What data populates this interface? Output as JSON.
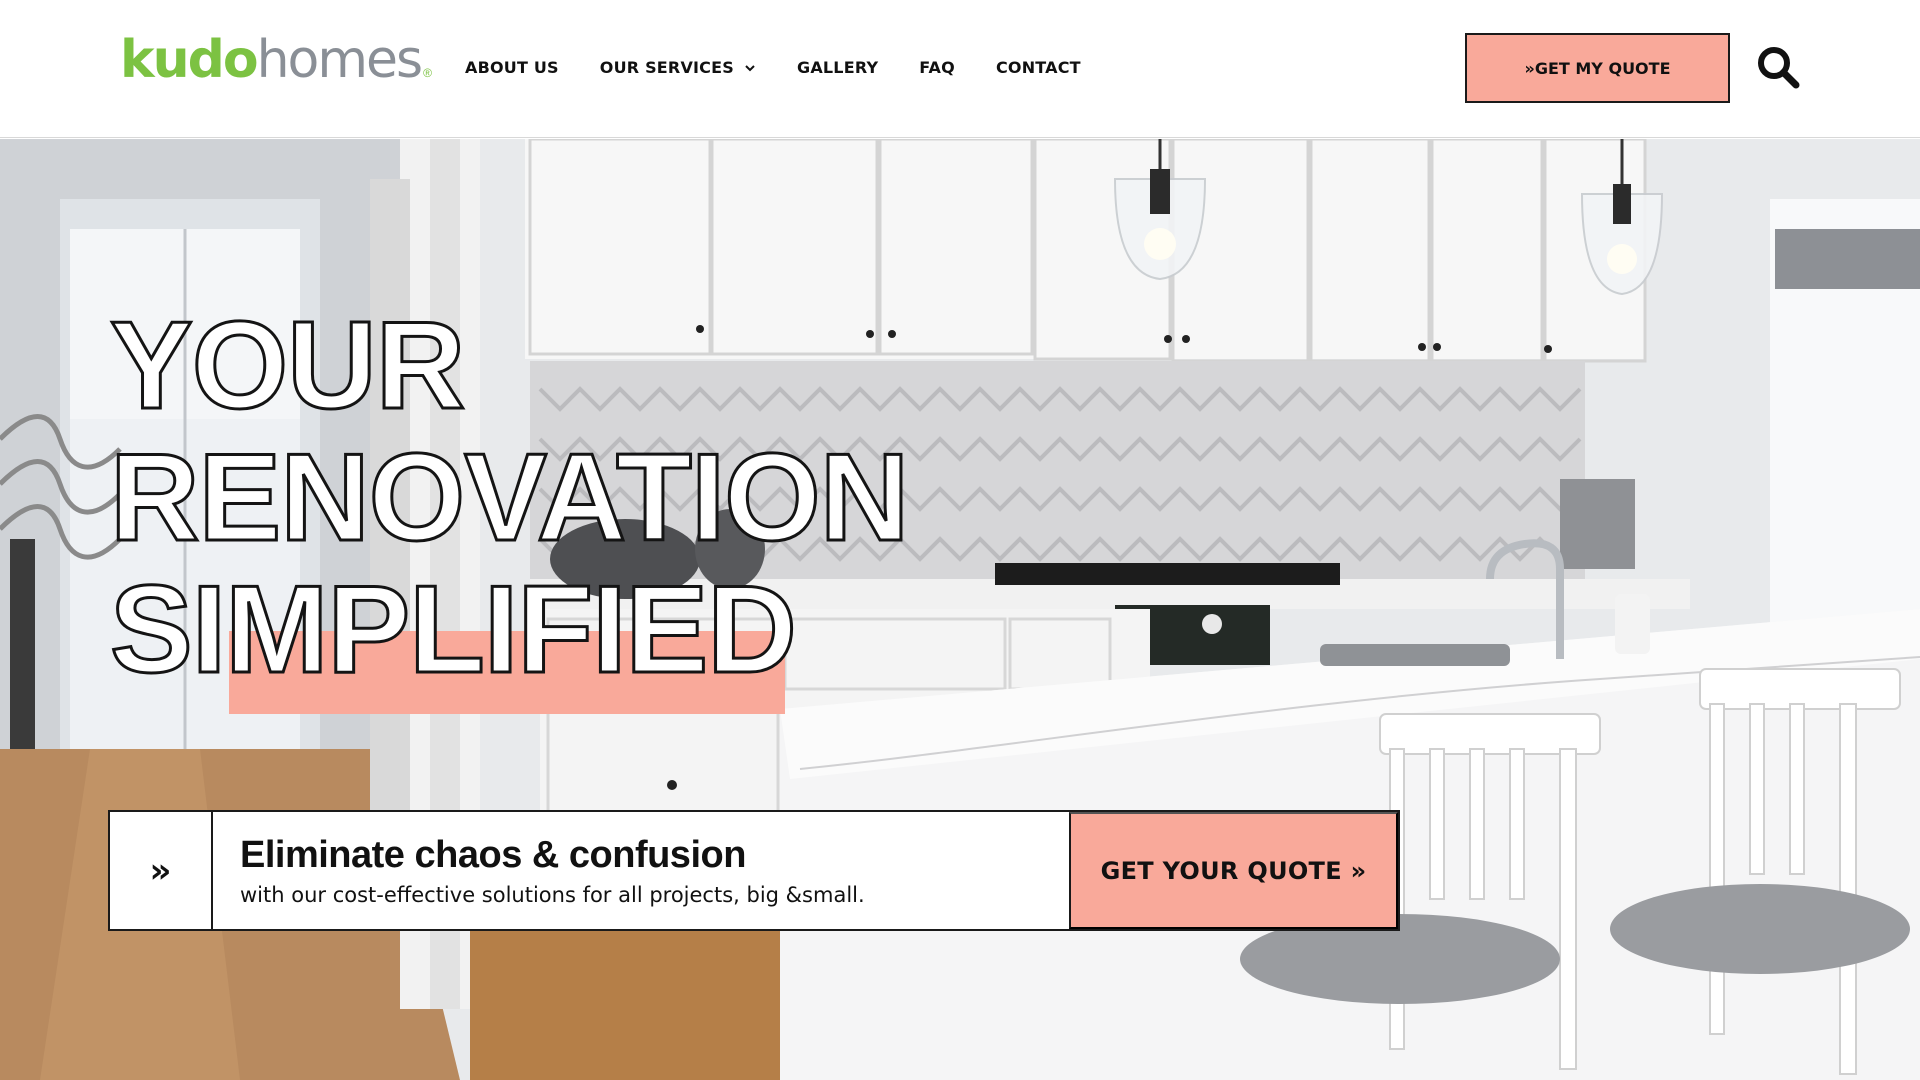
{
  "brand": {
    "logo_primary": "kudo",
    "logo_secondary": "homes",
    "logo_mark": "®",
    "primary_color": "#7cc242",
    "secondary_color": "#8a8f96",
    "accent_color": "#f9a99a"
  },
  "nav": {
    "items": [
      {
        "label": "ABOUT US"
      },
      {
        "label": "OUR SERVICES",
        "has_dropdown": true
      },
      {
        "label": "GALLERY"
      },
      {
        "label": "FAQ"
      },
      {
        "label": "CONTACT"
      }
    ]
  },
  "header": {
    "quote_button": "»GET MY QUOTE",
    "search_icon": "search-icon"
  },
  "hero": {
    "headline_lines": [
      "YOUR",
      "RENOVATION",
      "SIMPLIFIED"
    ],
    "background": "kitchen-renovation-photo"
  },
  "cta": {
    "arrow": "»",
    "title": "Eliminate chaos & confusion",
    "subtitle": "with our cost-effective solutions for all projects, big &small.",
    "button": "GET YOUR QUOTE »"
  }
}
